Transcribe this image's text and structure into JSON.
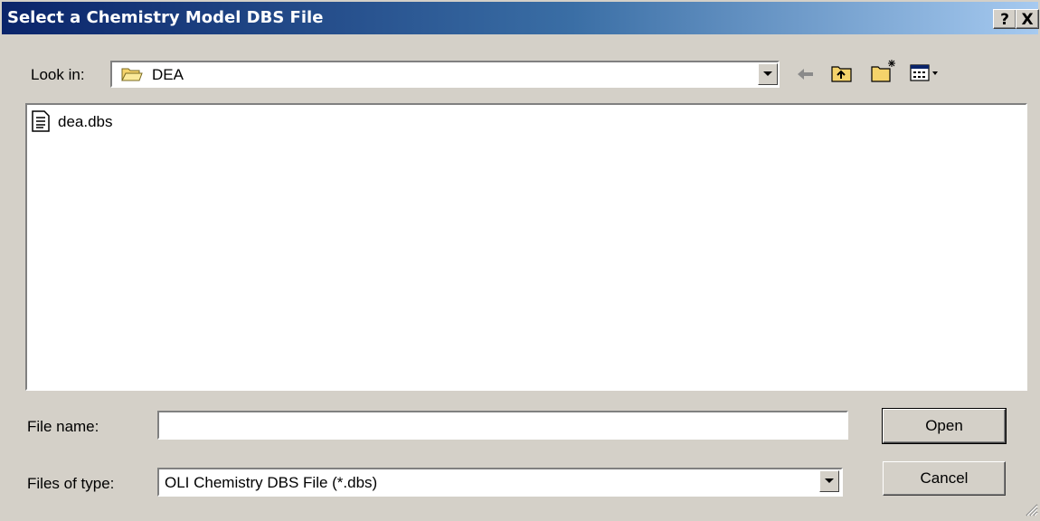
{
  "window": {
    "title": "Select a Chemistry Model DBS File",
    "help_label": "?",
    "close_label": "X"
  },
  "lookin": {
    "label": "Look in:",
    "value": "DEA",
    "folder_icon": "folder-open-icon"
  },
  "toolbar": {
    "icons": [
      "back-arrow-icon",
      "up-one-level-icon",
      "create-new-folder-icon",
      "view-menu-icon"
    ]
  },
  "files": [
    {
      "name": "dea.dbs",
      "icon": "document-icon"
    }
  ],
  "filename": {
    "label": "File name:",
    "value": ""
  },
  "filetype": {
    "label": "Files of type:",
    "value": "OLI Chemistry DBS File (*.dbs)"
  },
  "buttons": {
    "open": "Open",
    "cancel": "Cancel"
  },
  "colors": {
    "face": "#d4d0c8",
    "title_start": "#0a246a",
    "title_end": "#a6caf0",
    "folder": "#f5d36b"
  }
}
